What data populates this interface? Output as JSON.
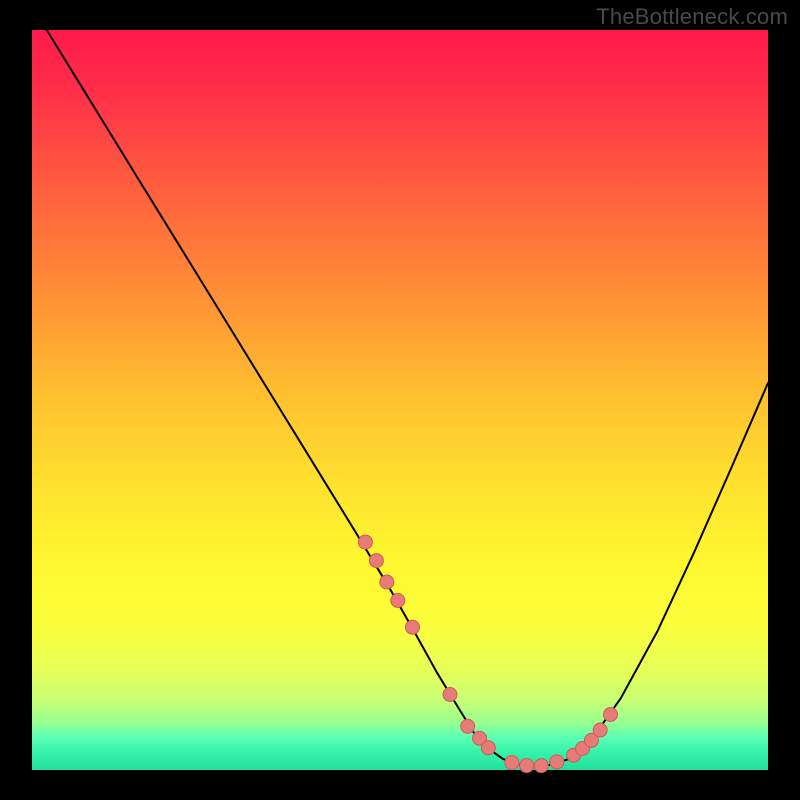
{
  "watermark": "TheBottleneck.com",
  "colors": {
    "black": "#000000",
    "curve": "#000000",
    "marker_fill": "#e77b78",
    "marker_stroke": "#cf5a57"
  },
  "chart_data": {
    "type": "line",
    "title": "",
    "xlabel": "",
    "ylabel": "",
    "xlim": [
      0,
      100
    ],
    "ylim": [
      0,
      100
    ],
    "grid": false,
    "legend": false,
    "background_gradient": [
      {
        "offset": 0.0,
        "color": "#ff1a4b"
      },
      {
        "offset": 0.08,
        "color": "#ff2e49"
      },
      {
        "offset": 0.2,
        "color": "#ff5a3f"
      },
      {
        "offset": 0.35,
        "color": "#ff8d36"
      },
      {
        "offset": 0.5,
        "color": "#ffc22f"
      },
      {
        "offset": 0.62,
        "color": "#ffe32f"
      },
      {
        "offset": 0.72,
        "color": "#fff730"
      },
      {
        "offset": 0.8,
        "color": "#fcff3a"
      },
      {
        "offset": 0.86,
        "color": "#eaff56"
      },
      {
        "offset": 0.905,
        "color": "#c9ff74"
      },
      {
        "offset": 0.935,
        "color": "#9bff8e"
      },
      {
        "offset": 0.955,
        "color": "#5dffb3"
      },
      {
        "offset": 0.975,
        "color": "#37f3ab"
      },
      {
        "offset": 1.0,
        "color": "#21e09d"
      }
    ],
    "series": [
      {
        "name": "bottleneck-curve",
        "x": [
          2,
          8,
          14,
          20,
          26,
          32,
          38,
          44,
          48.5,
          52,
          55,
          58,
          60,
          62,
          64,
          66,
          68,
          70,
          73,
          76,
          80,
          85,
          90,
          95,
          100
        ],
        "y": [
          100,
          90.3,
          80.6,
          70.9,
          61.2,
          51.5,
          41.8,
          32.1,
          24.7,
          18.6,
          13.2,
          8.3,
          5.1,
          2.9,
          1.5,
          0.8,
          0.5,
          0.6,
          1.5,
          4.1,
          9.7,
          18.8,
          29.5,
          40.8,
          52.3
        ]
      }
    ],
    "markers": {
      "name": "fit-markers",
      "x": [
        45.3,
        46.8,
        48.2,
        49.7,
        51.7,
        56.8,
        59.2,
        60.8,
        62.0,
        65.2,
        67.2,
        69.2,
        71.3,
        73.6,
        74.8,
        76.0,
        77.2,
        78.6
      ],
      "y": [
        30.8,
        28.3,
        25.4,
        22.9,
        19.3,
        10.2,
        5.9,
        4.3,
        3.0,
        1.0,
        0.6,
        0.6,
        1.1,
        2.0,
        2.9,
        4.0,
        5.4,
        7.5
      ]
    }
  }
}
